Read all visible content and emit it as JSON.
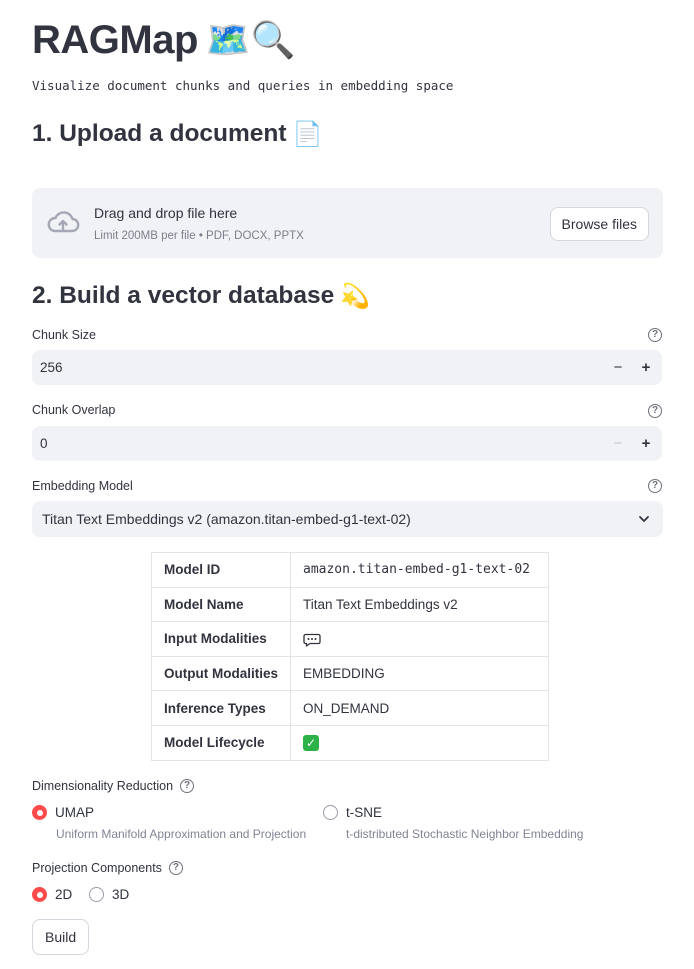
{
  "header": {
    "title": "RAGMap",
    "title_emojis": "🗺️🔍",
    "subtitle": "Visualize document chunks and queries in embedding space"
  },
  "upload_section": {
    "heading": "1. Upload a document",
    "heading_emoji": "📄",
    "dropzone_title": "Drag and drop file here",
    "dropzone_limit": "Limit 200MB per file • PDF, DOCX, PPTX",
    "browse_label": "Browse files"
  },
  "build_section": {
    "heading": "2. Build a vector database",
    "heading_emoji": "💫",
    "chunk_size": {
      "label": "Chunk Size",
      "value": "256"
    },
    "chunk_overlap": {
      "label": "Chunk Overlap",
      "value": "0"
    },
    "embedding_model": {
      "label": "Embedding Model",
      "selected": "Titan Text Embeddings v2 (amazon.titan-embed-g1-text-02)"
    },
    "model_table": [
      {
        "key": "Model ID",
        "value": "amazon.titan-embed-g1-text-02"
      },
      {
        "key": "Model Name",
        "value": "Titan Text Embeddings v2"
      },
      {
        "key": "Input Modalities",
        "value": ""
      },
      {
        "key": "Output Modalities",
        "value": "EMBEDDING"
      },
      {
        "key": "Inference Types",
        "value": "ON_DEMAND"
      },
      {
        "key": "Model Lifecycle",
        "value": ""
      }
    ],
    "dim_reduction": {
      "label": "Dimensionality Reduction",
      "options": [
        {
          "label": "UMAP",
          "desc": "Uniform Manifold Approximation and Projection",
          "selected": true
        },
        {
          "label": "t-SNE",
          "desc": "t-distributed Stochastic Neighbor Embedding",
          "selected": false
        }
      ]
    },
    "projection": {
      "label": "Projection Components",
      "options": [
        {
          "label": "2D",
          "selected": true
        },
        {
          "label": "3D",
          "selected": false
        }
      ]
    },
    "build_label": "Build"
  },
  "icons": {
    "help": "question-circle-icon",
    "upload": "cloud-upload-icon",
    "select": "chevron-down-icon",
    "input_modality": "speech-bubble-icon",
    "lifecycle": "green-check-icon"
  },
  "colors": {
    "text": "#31333F",
    "muted": "#808495",
    "input_bg": "#F0F2F6",
    "radio_active": "#FF4B4B",
    "check_green": "#2DB24A"
  }
}
